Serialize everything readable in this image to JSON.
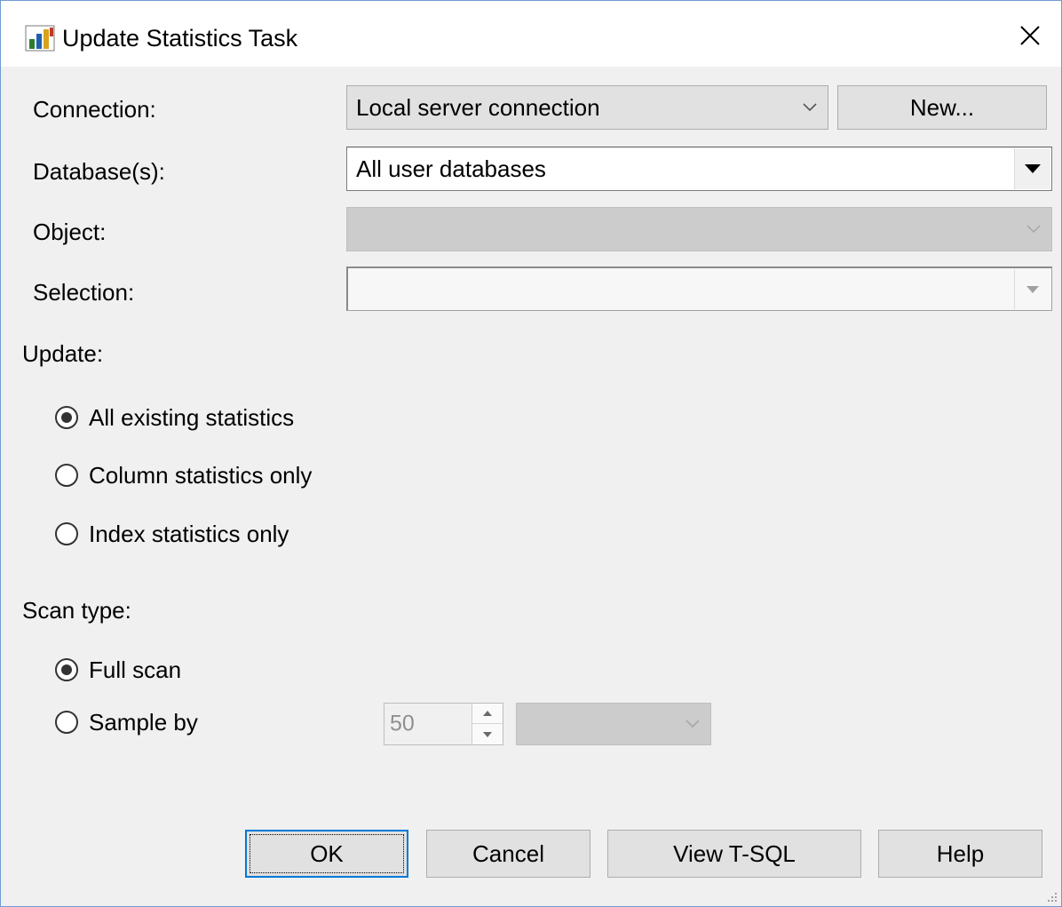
{
  "window": {
    "title": "Update Statistics Task"
  },
  "connection": {
    "label": "Connection:",
    "value": "Local server connection",
    "new_button": "New..."
  },
  "databases": {
    "label": "Database(s):",
    "value": "All user databases"
  },
  "object": {
    "label": "Object:",
    "value": ""
  },
  "selection": {
    "label": "Selection:",
    "value": ""
  },
  "update": {
    "label": "Update:",
    "options": [
      "All existing statistics",
      "Column statistics only",
      "Index statistics only"
    ],
    "selected": "All existing statistics"
  },
  "scan_type": {
    "label": "Scan type:",
    "options": [
      "Full scan",
      "Sample by"
    ],
    "selected": "Full scan",
    "sample_value": "50",
    "sample_unit": ""
  },
  "buttons": {
    "ok": "OK",
    "cancel": "Cancel",
    "view_tsql": "View T-SQL",
    "help": "Help"
  },
  "icons": {
    "title": "statistics-chart-icon",
    "close": "close-icon"
  },
  "colors": {
    "focus_border": "#0078d7",
    "disabled_fill": "#cccccc",
    "window_border": "#6f9bd1"
  }
}
